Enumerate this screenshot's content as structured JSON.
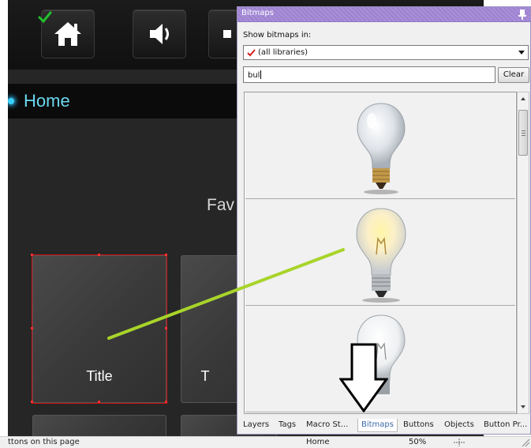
{
  "app": {
    "home_label": "Home",
    "fav_label": "Fav",
    "tiles": [
      {
        "label": "Title"
      },
      {
        "label": "T"
      }
    ],
    "icons": [
      "check-icon",
      "home-icon",
      "speaker-icon"
    ]
  },
  "panel": {
    "title": "Bitmaps",
    "show_label": "Show bitmaps in:",
    "library_value": "(all libraries)",
    "search_value": "bul",
    "clear_label": "Clear",
    "thumbnails": [
      "light-bulb-off",
      "light-bulb-lit",
      "light-bulb-clear"
    ],
    "tabs": [
      "Layers",
      "Tags",
      "Macro St...",
      "Bitmaps",
      "Buttons",
      "Objects",
      "Button Pr..."
    ],
    "active_tab": "Bitmaps"
  },
  "statusbar": {
    "left_text": "ttons on this page",
    "page": "Home",
    "zoom": "50%"
  },
  "colors": {
    "accent_line": "#a8d42a",
    "panel_title": "#a98fd9",
    "home_text": "#6bd8f0",
    "selection": "#d01010"
  }
}
